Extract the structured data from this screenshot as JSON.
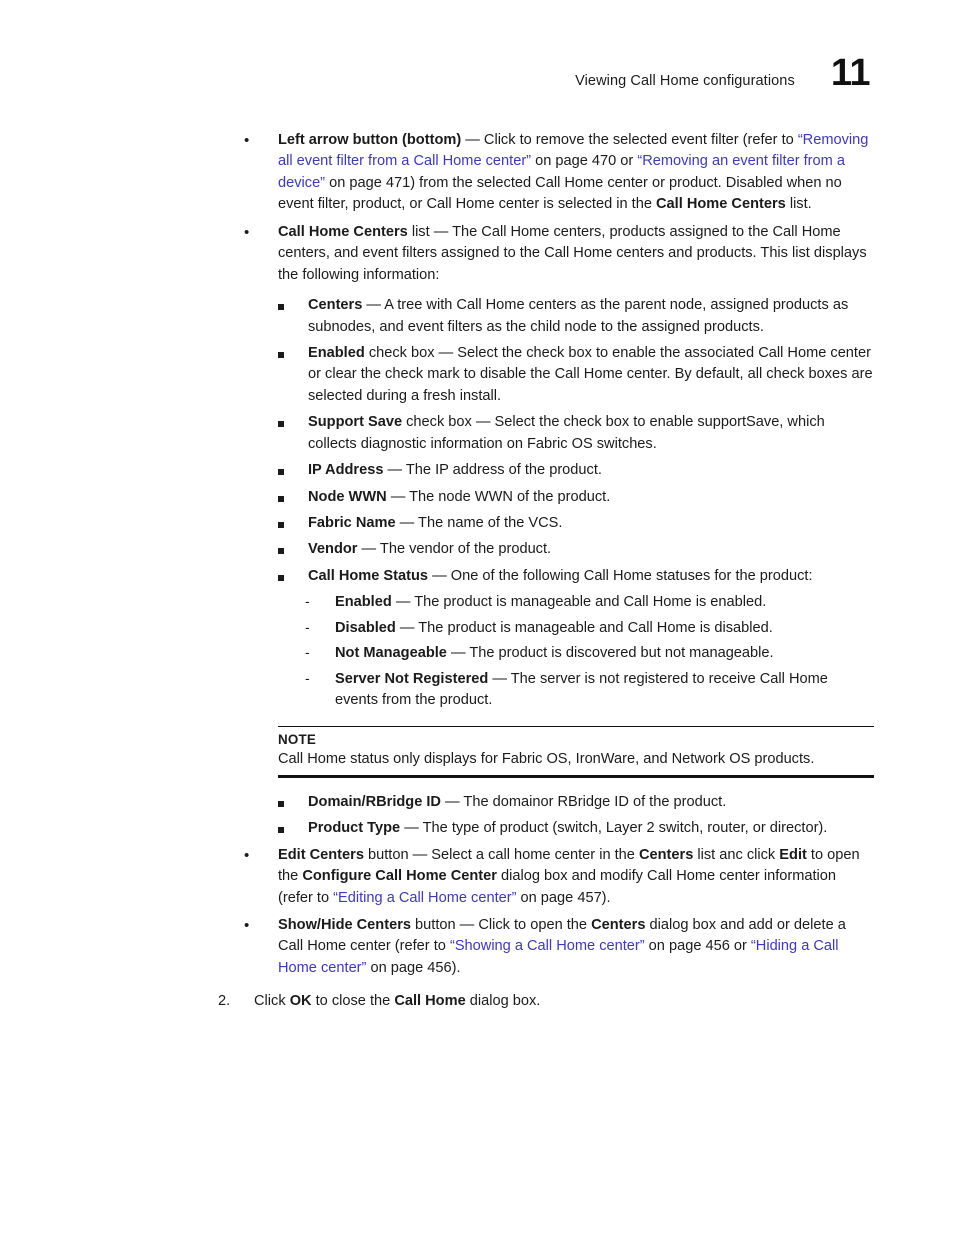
{
  "header": {
    "title": "Viewing Call Home configurations",
    "chapter": "11"
  },
  "bullets": {
    "left_arrow": {
      "lead": "Left arrow button (bottom)",
      "t1": " — Click to remove the selected event filter (refer to ",
      "link1": "“Removing all event filter from a Call Home center”",
      "t2": " on page 470 or ",
      "link2": "“Removing an event filter from a device”",
      "t3": " on page 471) from the selected Call Home center or product. Disabled when no event filter, product, or Call Home center is selected in the ",
      "bold_end": "Call Home Centers",
      "t4": " list."
    },
    "call_home_centers": {
      "lead": "Call Home Centers",
      "t1": " list — The Call Home centers, products assigned to the Call Home centers, and event filters assigned to the Call Home centers and products. This list displays the following information:"
    },
    "edit_centers": {
      "lead": "Edit Centers",
      "t1": " button — Select a call home center in the ",
      "b2": "Centers",
      "t2": " list anc click ",
      "b3": "Edit",
      "t3": " to open the ",
      "b4": "Configure Call Home Center",
      "t4": " dialog box and modify Call Home center information (refer to ",
      "link1": "“Editing a Call Home center”",
      "t5": " on page 457)."
    },
    "show_hide_centers": {
      "lead": "Show/Hide Centers",
      "t1": " button — Click to open the ",
      "b2": "Centers",
      "t2": " dialog box and add or delete a Call Home center (refer to ",
      "link1": "“Showing a Call Home center”",
      "t3": " on page 456 or ",
      "link2": "“Hiding a Call Home center”",
      "t4": " on page 456)."
    }
  },
  "sub_items": {
    "centers": {
      "lead": "Centers",
      "t1": " — A tree with Call Home centers as the parent node, assigned products as subnodes, and event filters as the child node to the assigned products."
    },
    "enabled": {
      "lead": "Enabled",
      "t1": " check box — Select the check box to enable the associated Call Home center or clear the check mark to disable the Call Home center. By default, all check boxes are selected during a fresh install."
    },
    "support_save": {
      "lead": "Support Save",
      "t1": " check box — Select the check box to enable supportSave, which collects diagnostic information on Fabric OS switches."
    },
    "ip_address": {
      "lead": "IP Address",
      "t1": " — The IP address of the product."
    },
    "node_wwn": {
      "lead": "Node WWN",
      "t1": " — The node WWN of the product."
    },
    "fabric_name": {
      "lead": "Fabric Name",
      "t1": " — The name of the VCS."
    },
    "vendor": {
      "lead": "Vendor",
      "t1": " — The vendor of the product."
    },
    "call_home_status": {
      "lead": "Call Home Status",
      "t1": " — One of the following Call Home statuses for the product:"
    },
    "domain_rbridge": {
      "lead": "Domain/RBridge ID",
      "t1": "  — The domainor RBridge ID of the product."
    },
    "product_type": {
      "lead": "Product Type",
      "t1": " — The type of product (switch, Layer 2 switch, router, or director)."
    }
  },
  "statuses": {
    "enabled": {
      "lead": "Enabled",
      "t1": " — The product is manageable and Call Home is enabled."
    },
    "disabled": {
      "lead": "Disabled",
      "t1": " — The product is manageable and Call Home is disabled."
    },
    "not_manageable": {
      "lead": "Not Manageable",
      "t1": " — The product is discovered but not manageable."
    },
    "server_not_registered": {
      "lead": "Server Not Registered",
      "t1": " — The server is not registered to receive Call Home events from the product."
    }
  },
  "note": {
    "label": "NOTE",
    "text": "Call Home status only displays for Fabric OS, IronWare, and Network OS products."
  },
  "step2": {
    "number": "2.",
    "t1": "Click ",
    "b1": "OK",
    "t2": " to close the ",
    "b2": "Call Home",
    "t3": " dialog box."
  },
  "colors": {
    "link": "#3b37c9",
    "text": "#1b1b1b"
  }
}
